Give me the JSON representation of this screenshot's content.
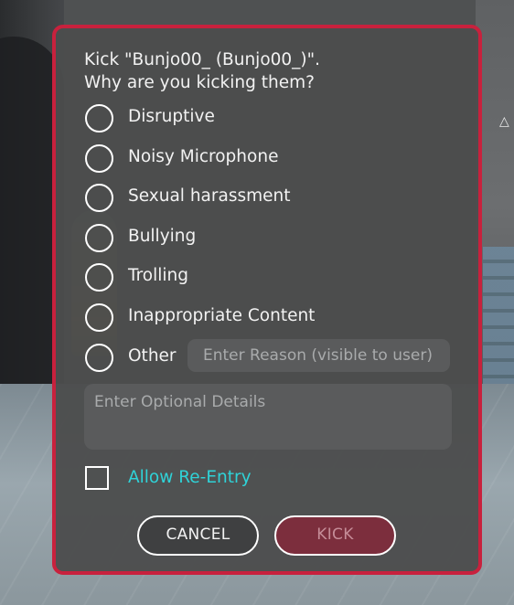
{
  "dialog": {
    "title_line1": "Kick \"Bunjo00_ (Bunjo00_)\".",
    "title_line2": "Why are you kicking them?",
    "reasons": [
      {
        "label": "Disruptive",
        "selected": false
      },
      {
        "label": "Noisy Microphone",
        "selected": false
      },
      {
        "label": "Sexual harassment",
        "selected": false
      },
      {
        "label": "Bullying",
        "selected": false
      },
      {
        "label": "Trolling",
        "selected": false
      },
      {
        "label": "Inappropriate Content",
        "selected": false
      },
      {
        "label": "Other",
        "selected": false
      }
    ],
    "other_reason_placeholder": "Enter Reason (visible to user)",
    "details_placeholder": "Enter Optional Details",
    "allow_reentry_label": "Allow Re-Entry",
    "allow_reentry_checked": false,
    "cancel_label": "CANCEL",
    "kick_label": "KICK"
  },
  "colors": {
    "border": "#c8213d",
    "panel": "#4c4d4d",
    "accent_text": "#2fd3d8",
    "kick_button": "#7c2e3d"
  },
  "icons": {
    "cursor": "pointer-cursor-icon"
  }
}
